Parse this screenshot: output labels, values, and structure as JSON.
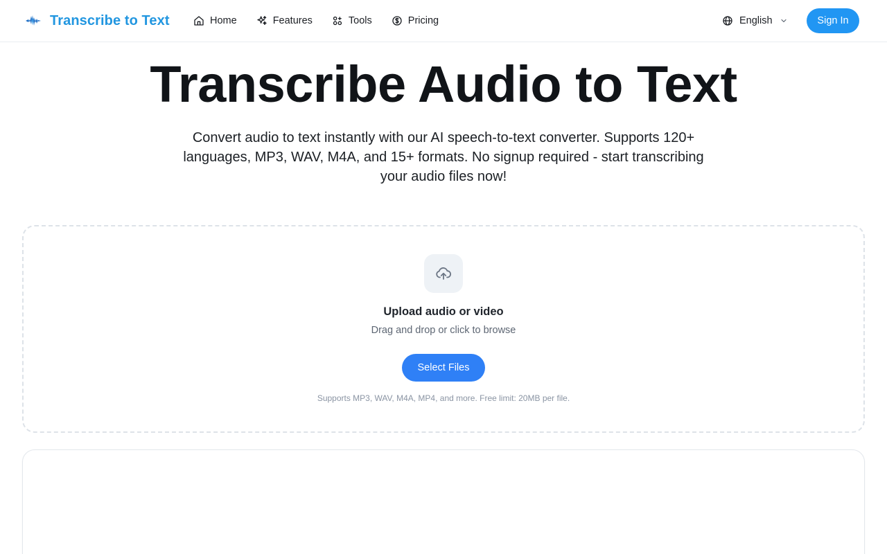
{
  "header": {
    "brand": "Transcribe to Text",
    "nav": [
      {
        "label": "Home",
        "icon": "home-icon"
      },
      {
        "label": "Features",
        "icon": "sparkles-icon"
      },
      {
        "label": "Tools",
        "icon": "tools-icon"
      },
      {
        "label": "Pricing",
        "icon": "dollar-circle-icon"
      }
    ],
    "language": "English",
    "sign_in": "Sign In"
  },
  "hero": {
    "title": "Transcribe Audio to Text",
    "subtitle": "Convert audio to text instantly with our AI speech-to-text converter. Supports 120+ languages, MP3, WAV, M4A, and 15+ formats. No signup required - start transcribing your audio files now!"
  },
  "upload": {
    "icon": "upload-cloud-icon",
    "title": "Upload audio or video",
    "hint": "Drag and drop or click to browse",
    "button": "Select Files",
    "note": "Supports MP3, WAV, M4A, MP4, and more. Free limit: 20MB per file."
  },
  "colors": {
    "brand": "#2196e0",
    "sign_in_bg": "#2196f3",
    "primary_button": "#2f80f6"
  }
}
